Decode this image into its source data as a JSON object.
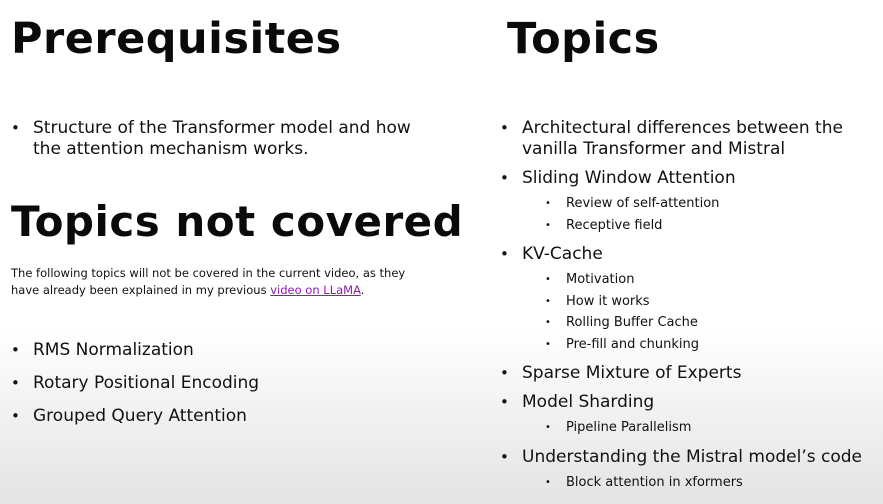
{
  "left": {
    "prerequisites_title": "Prerequisites",
    "prerequisites": [
      "Structure of the Transformer model and how the attention mechanism works."
    ],
    "not_covered_title": "Topics not covered",
    "note_before_link": "The following topics will not be covered in the current video, as they have already been explained in my previous ",
    "note_link": "video on LLaMA",
    "note_after_link": ".",
    "not_covered": [
      "RMS Normalization",
      "Rotary Positional Encoding",
      "Grouped Query Attention"
    ]
  },
  "right": {
    "topics_title": "Topics",
    "topics": [
      {
        "label": "Architectural differences between the vanilla Transformer and Mistral",
        "sub": []
      },
      {
        "label": "Sliding Window Attention",
        "sub": [
          "Review of self-attention",
          "Receptive field"
        ]
      },
      {
        "label": "KV-Cache",
        "sub": [
          "Motivation",
          "How it works",
          "Rolling Buffer Cache",
          "Pre-fill and chunking"
        ]
      },
      {
        "label": "Sparse Mixture of Experts",
        "sub": []
      },
      {
        "label": "Model Sharding",
        "sub": [
          "Pipeline Parallelism"
        ]
      },
      {
        "label": "Understanding the Mistral model’s code",
        "sub": [
          "Block attention in xformers"
        ]
      }
    ]
  },
  "colors": {
    "text": "#111111",
    "link": "#8a1fa0"
  }
}
